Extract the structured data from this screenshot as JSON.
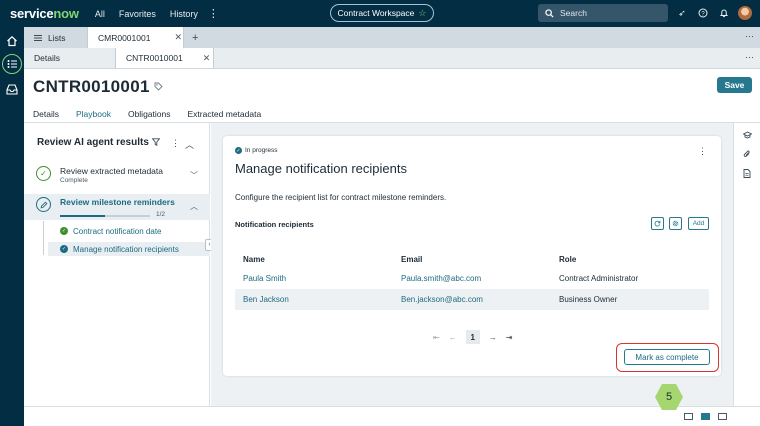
{
  "topnav": {
    "logo_service": "service",
    "logo_now": "now",
    "items": [
      "All",
      "Favorites",
      "History"
    ],
    "workspace": "Contract Workspace",
    "search_placeholder": "Search"
  },
  "tabs_primary": [
    {
      "label": "Lists"
    },
    {
      "label": "CMR0001001"
    }
  ],
  "tabs_secondary": [
    {
      "label": "Details"
    },
    {
      "label": "CNTR0010001"
    }
  ],
  "record": {
    "title": "CNTR0010001",
    "save_label": "Save",
    "subtabs": [
      "Details",
      "Playbook",
      "Obligations",
      "Extracted metadata"
    ]
  },
  "playbook": {
    "title": "Review AI agent results",
    "steps": [
      {
        "label": "Review extracted metadata",
        "sub": "Complete"
      },
      {
        "label": "Review milestone reminders",
        "progress_text": "1/2",
        "progress": 0.5
      }
    ],
    "substeps": [
      "Contract notification date",
      "Manage notification recipients"
    ]
  },
  "card": {
    "status": "In progress",
    "title": "Manage notification recipients",
    "description": "Configure the recipient list for contract milestone reminders.",
    "section_title": "Notification recipients",
    "add_label": "Add",
    "columns": [
      "Name",
      "Email",
      "Role"
    ],
    "rows": [
      {
        "name": "Paula Smith",
        "email": "Paula.smith@abc.com",
        "role": "Contract Administrator"
      },
      {
        "name": "Ben Jackson",
        "email": "Ben.jackson@abc.com",
        "role": "Business Owner"
      }
    ],
    "page": "1",
    "complete_label": "Mark as complete"
  },
  "step_badge": "5",
  "colors": {
    "nav_bg": "#032d42",
    "accent": "#26788f",
    "brand_green": "#81d674",
    "highlight": "#d9332b",
    "badge": "#a6d66f"
  }
}
